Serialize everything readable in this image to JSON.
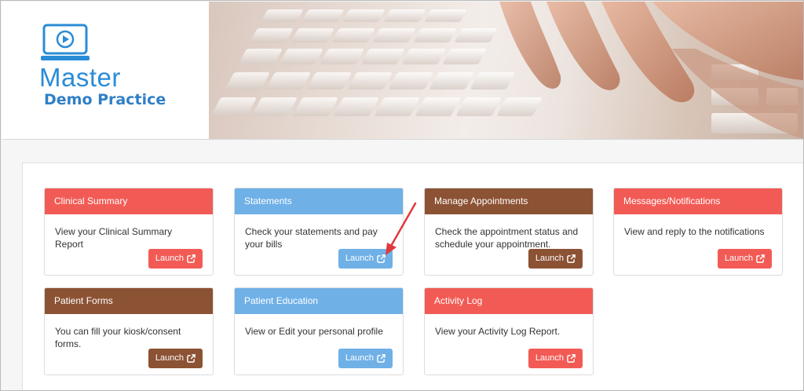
{
  "brand": {
    "line1": "Master",
    "line2": "Demo Practice",
    "colors": {
      "primary": "#2b8cd6"
    }
  },
  "banner": {
    "image": "hands-typing-on-keyboard"
  },
  "cards": [
    {
      "title": "Clinical Summary",
      "description": "View your Clinical Summary Report",
      "button": "Launch",
      "color": "#f25b55"
    },
    {
      "title": "Statements",
      "description": "Check your statements and pay your bills",
      "button": "Launch",
      "color": "#6fb0e7"
    },
    {
      "title": "Manage Appointments",
      "description": "Check the appointment status and schedule your appointment.",
      "button": "Launch",
      "color": "#8c5234"
    },
    {
      "title": "Messages/Notifications",
      "description": "View and reply to the notifications",
      "button": "Launch",
      "color": "#f25b55"
    },
    {
      "title": "Patient Forms",
      "description": "You can fill your kiosk/consent forms.",
      "button": "Launch",
      "color": "#8c5234"
    },
    {
      "title": "Patient Education",
      "description": "View or Edit your personal profile",
      "button": "Launch",
      "color": "#6fb0e7"
    },
    {
      "title": "Activity Log",
      "description": "View your Activity Log Report.",
      "button": "Launch",
      "color": "#f25b55"
    }
  ],
  "annotation": {
    "arrow_color": "#e0393e"
  },
  "icons": {
    "launch": "external-link-icon",
    "logo": "laptop-play-icon"
  }
}
